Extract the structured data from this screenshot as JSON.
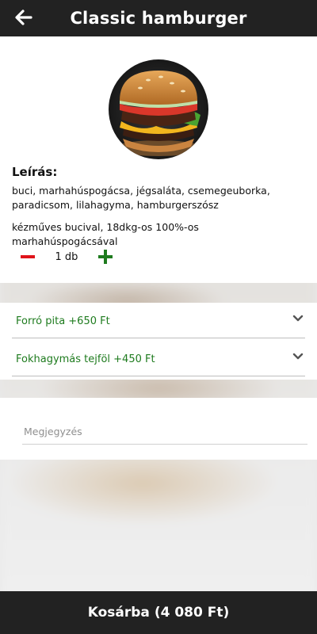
{
  "header": {
    "title": "Classic hamburger",
    "back_icon": "arrow-left-icon"
  },
  "product": {
    "image_icon": "hamburger-photo",
    "description_heading": "Leírás:",
    "ingredients": "buci, marhahúspogácsa, jégsaláta, csemegeuborka, paradicsom, lilahagyma, hamburgerszósz",
    "details": "kézműves bucival, 18dkg-os 100%-os marhahúspogácsával"
  },
  "quantity": {
    "value": "1 db",
    "minus_icon": "minus-icon",
    "plus_icon": "plus-icon"
  },
  "options": [
    {
      "label": "Forró pita +650 Ft",
      "icon": "chevron-down-icon"
    },
    {
      "label": "Fokhagymás tejföl +450 Ft",
      "icon": "chevron-down-icon"
    }
  ],
  "note": {
    "placeholder": "Megjegyzés",
    "value": ""
  },
  "footer": {
    "cart_button": "Kosárba (4 080 Ft)"
  },
  "colors": {
    "header_bg": "#222222",
    "option_text": "#1e7b1e",
    "minus": "#e0141a",
    "plus": "#1e7b1e"
  }
}
